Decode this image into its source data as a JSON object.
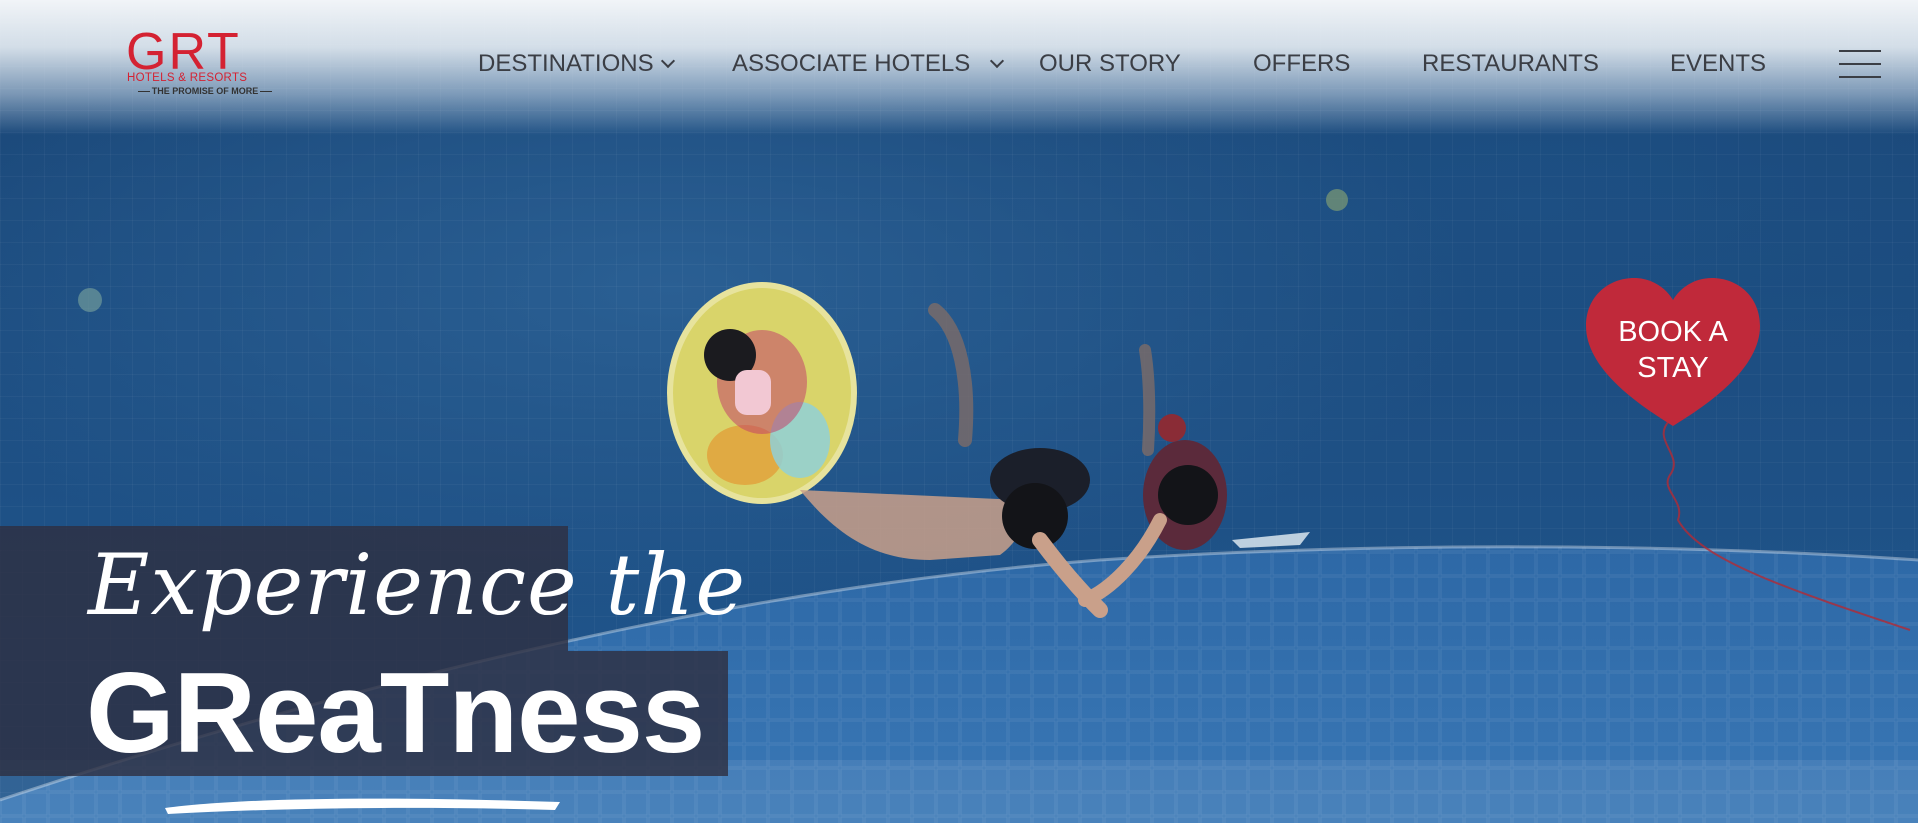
{
  "brand": {
    "logo_main": "GRT",
    "logo_sub": "HOTELS & RESORTS",
    "logo_tagline": "THE PROMISE OF MORE",
    "brand_red": "#d42232"
  },
  "nav": {
    "items": [
      {
        "label": "DESTINATIONS",
        "has_dropdown": true
      },
      {
        "label": "ASSOCIATE HOTELS",
        "has_dropdown": true
      },
      {
        "label": "OUR STORY",
        "has_dropdown": false
      },
      {
        "label": "OFFERS",
        "has_dropdown": false
      },
      {
        "label": "RESTAURANTS",
        "has_dropdown": false
      },
      {
        "label": "EVENTS",
        "has_dropdown": false
      }
    ],
    "menu_icon": "hamburger-menu-icon"
  },
  "cta": {
    "book_label_line1": "BOOK A",
    "book_label_line2": "STAY",
    "color": "#c0293a"
  },
  "hero": {
    "headline_script": "Experience the",
    "headline_bold": "GReaTness",
    "band_color": "#2e3042"
  }
}
